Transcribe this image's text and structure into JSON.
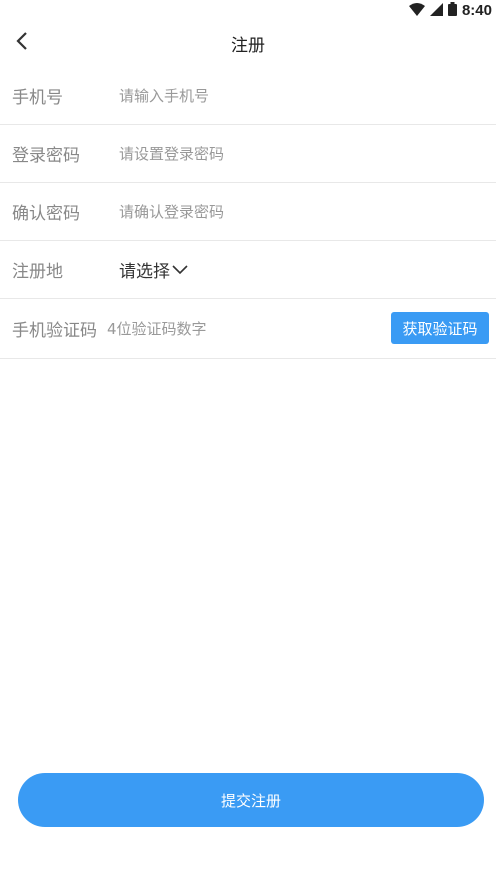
{
  "status_bar": {
    "time": "8:40",
    "icons": [
      "wifi-icon",
      "cell-signal-icon",
      "battery-icon"
    ]
  },
  "nav": {
    "title": "注册",
    "back_icon": "chevron-left-icon"
  },
  "form": {
    "phone": {
      "label": "手机号",
      "placeholder": "请输入手机号"
    },
    "password": {
      "label": "登录密码",
      "placeholder": "请设置登录密码"
    },
    "confirm_password": {
      "label": "确认密码",
      "placeholder": "请确认登录密码"
    },
    "region": {
      "label": "注册地",
      "value": "请选择",
      "icon": "chevron-down-icon"
    },
    "sms_code": {
      "label": "手机验证码",
      "placeholder": "4位验证码数字",
      "button_label": "获取验证码"
    }
  },
  "submit": {
    "label": "提交注册"
  },
  "colors": {
    "accent": "#3a9bf4",
    "divider": "#e8e8e8",
    "label": "#888888"
  }
}
